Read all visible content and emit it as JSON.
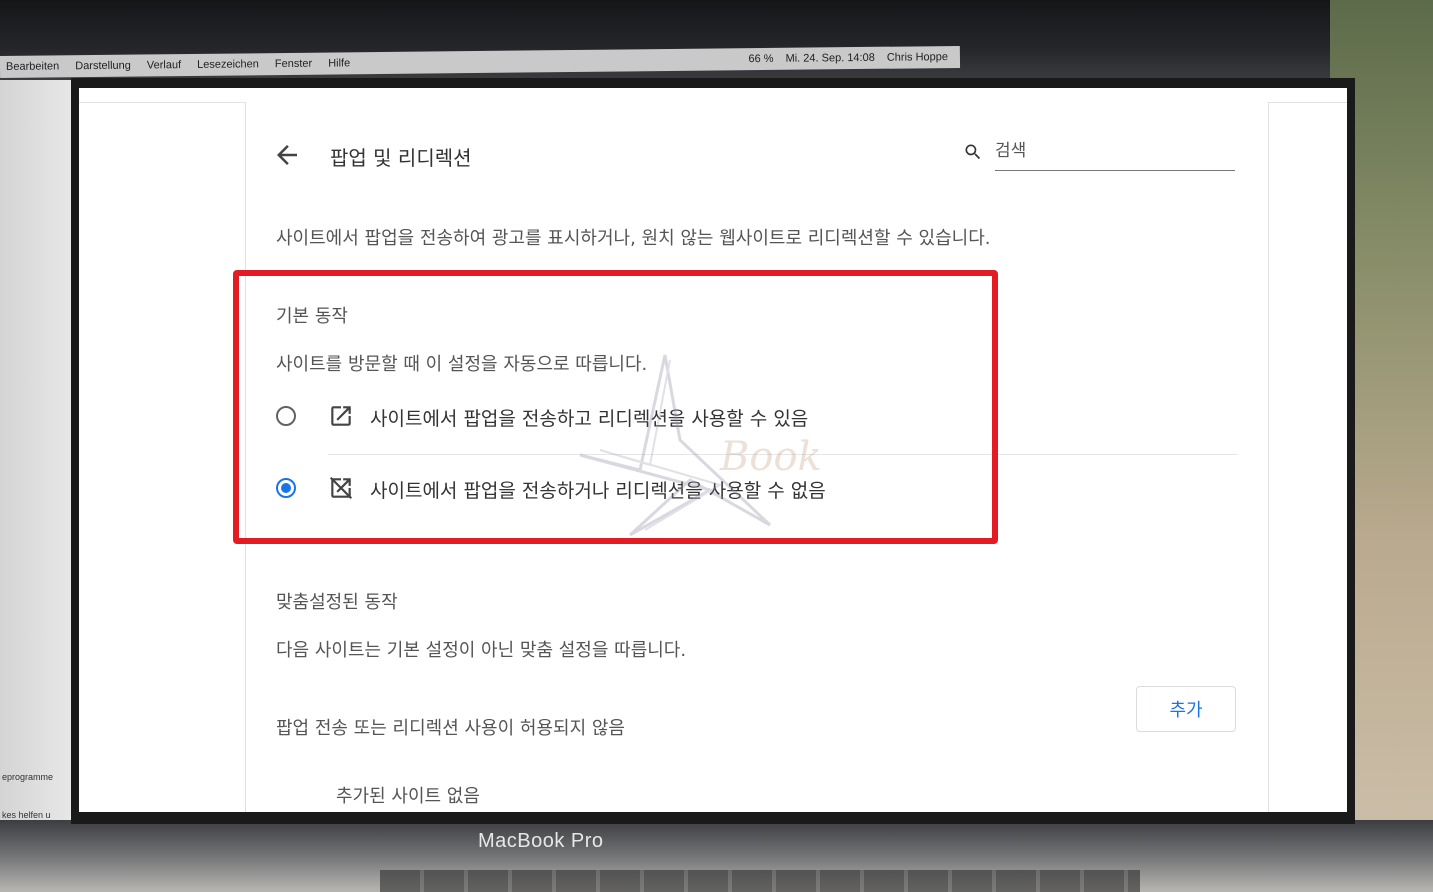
{
  "background": {
    "menubar": {
      "items": [
        "Bearbeiten",
        "Darstellung",
        "Verlauf",
        "Lesezeichen",
        "Fenster",
        "Hilfe"
      ],
      "status": [
        "66 %",
        "Mi. 24. Sep. 14:08",
        "Chris Hoppe"
      ]
    },
    "left_window_lines": [
      "eprogramme",
      "kes helfen u"
    ],
    "device_label": "MacBook Pro"
  },
  "header": {
    "title": "팝업 및 리디렉션",
    "search_placeholder": "검색"
  },
  "description": "사이트에서 팝업을 전송하여 광고를 표시하거나, 원치 않는 웹사이트로 리디렉션할 수 있습니다.",
  "default_behavior": {
    "title": "기본 동작",
    "subtitle": "사이트를 방문할 때 이 설정을 자동으로 따릅니다.",
    "options": [
      {
        "label": "사이트에서 팝업을 전송하고 리디렉션을 사용할 수 있음",
        "icon": "open-in-new-icon",
        "checked": false
      },
      {
        "label": "사이트에서 팝업을 전송하거나 리디렉션을 사용할 수 없음",
        "icon": "open-in-new-off-icon",
        "checked": true
      }
    ]
  },
  "custom_behavior": {
    "title": "맞춤설정된 동작",
    "subtitle": "다음 사이트는 기본 설정이 아닌 맞춤 설정을 따릅니다.",
    "blocked_section": {
      "label": "팝업 전송 또는 리디렉션 사용이 허용되지 않음",
      "add_button": "추가",
      "empty_text": "추가된 사이트 없음"
    }
  },
  "colors": {
    "accent": "#1a73e8",
    "highlight_border": "#e21b25"
  }
}
